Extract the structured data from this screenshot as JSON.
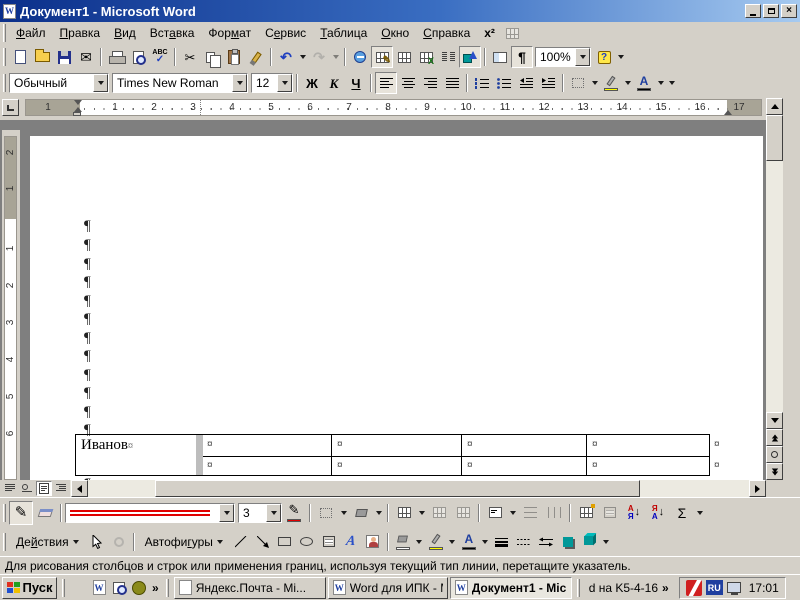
{
  "window": {
    "title": "Документ1 - Microsoft Word"
  },
  "menubar": {
    "items": [
      {
        "label": "Файл",
        "accel": 0
      },
      {
        "label": "Правка",
        "accel": 0
      },
      {
        "label": "Вид",
        "accel": 0
      },
      {
        "label": "Вставка",
        "accel": 3
      },
      {
        "label": "Формат",
        "accel": 3
      },
      {
        "label": "Сервис",
        "accel": 1
      },
      {
        "label": "Таблица",
        "accel": 0
      },
      {
        "label": "Окно",
        "accel": 0
      },
      {
        "label": "Справка",
        "accel": 0
      }
    ],
    "extra": "x²"
  },
  "standard": {
    "zoom_value": "100%",
    "spelling": "ABC"
  },
  "formatting": {
    "style": "Обычный",
    "font": "Times New Roman",
    "size": "12",
    "bold": "Ж",
    "italic": "К",
    "underline": "Ч"
  },
  "ruler": {
    "margin_number": "1",
    "h_numbers": [
      "1",
      "2",
      "3",
      "4",
      "5",
      "6",
      "7",
      "8",
      "9",
      "10",
      "11",
      "12",
      "13",
      "14",
      "15",
      "16",
      "17"
    ],
    "v_margin_numbers": [
      "2",
      "1"
    ],
    "v_numbers": [
      "1",
      "2",
      "3",
      "4",
      "5",
      "6"
    ]
  },
  "document": {
    "pilcrow": "¶",
    "table_text": "Иванов",
    "cell_marker": "¤"
  },
  "tables_toolbar": {
    "line_weight": "3",
    "autosum": "Σ",
    "sort_a": "А",
    "sort_z": "Я"
  },
  "drawing_toolbar": {
    "draw_menu": {
      "label": "Действия",
      "accel": 2
    },
    "autoshapes": {
      "label": "Автофигуры",
      "accel": 6
    }
  },
  "statusbar": {
    "text": "Для рисования столбцов и строк или применения границ, используя текущий тип линии, перетащите указатель."
  },
  "taskbar": {
    "start_label": "Пуск",
    "chevron": "»",
    "tasks": [
      {
        "label": "Яндекс.Почта - Mi..."
      },
      {
        "label": "Word для ИПК - Mi..."
      },
      {
        "label": "Документ1 - Mic..."
      }
    ],
    "deskband": "d на K5-4-16",
    "tray": {
      "lang": "RU",
      "time": "17:01"
    }
  },
  "icons": {
    "mail": "✉",
    "cut": "✂",
    "undo": "↶",
    "redo": "↷",
    "pilcrow": "¶",
    "help": "?",
    "check": "✓",
    "pencil": "✎",
    "excel_x": "X",
    "word_w": "W",
    "wordart_a": "A",
    "down_arrow": "↓",
    "close": "×"
  }
}
